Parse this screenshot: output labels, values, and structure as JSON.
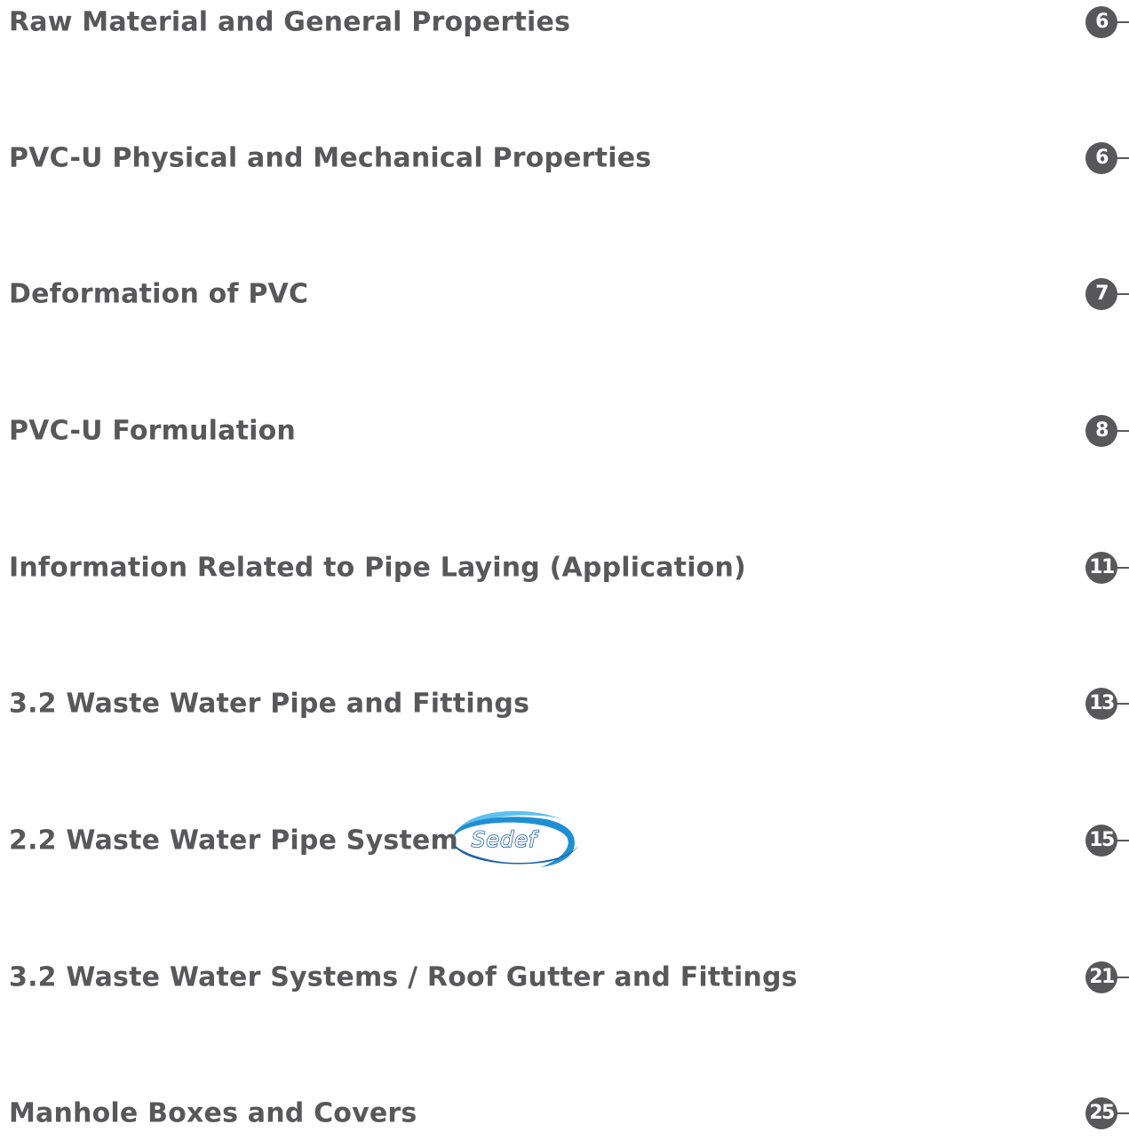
{
  "toc": {
    "entries": [
      {
        "title": "Raw Material and General Properties",
        "page": "6"
      },
      {
        "title": "PVC-U Physical and Mechanical Properties",
        "page": "6"
      },
      {
        "title": "Deformation of PVC",
        "page": "7"
      },
      {
        "title": "PVC-U Formulation",
        "page": "8"
      },
      {
        "title": "Information Related to Pipe Laying (Application)",
        "page": "11"
      },
      {
        "title": "3.2 Waste Water Pipe and Fittings",
        "page": "13"
      },
      {
        "title": "2.2 Waste Water Pipe System",
        "page": "15"
      },
      {
        "title": "3.2 Waste Water Systems / Roof Gutter and Fittings",
        "page": "21"
      },
      {
        "title": "Manhole Boxes and Covers",
        "page": "25"
      }
    ]
  },
  "logo": {
    "text": "Sedef",
    "colors": {
      "primary": "#1f8fd4",
      "dark": "#1b5fa8",
      "light": "#5ec0ee"
    }
  },
  "colors": {
    "text": "#58585a",
    "marker": "#58585a",
    "background": "#ffffff"
  }
}
